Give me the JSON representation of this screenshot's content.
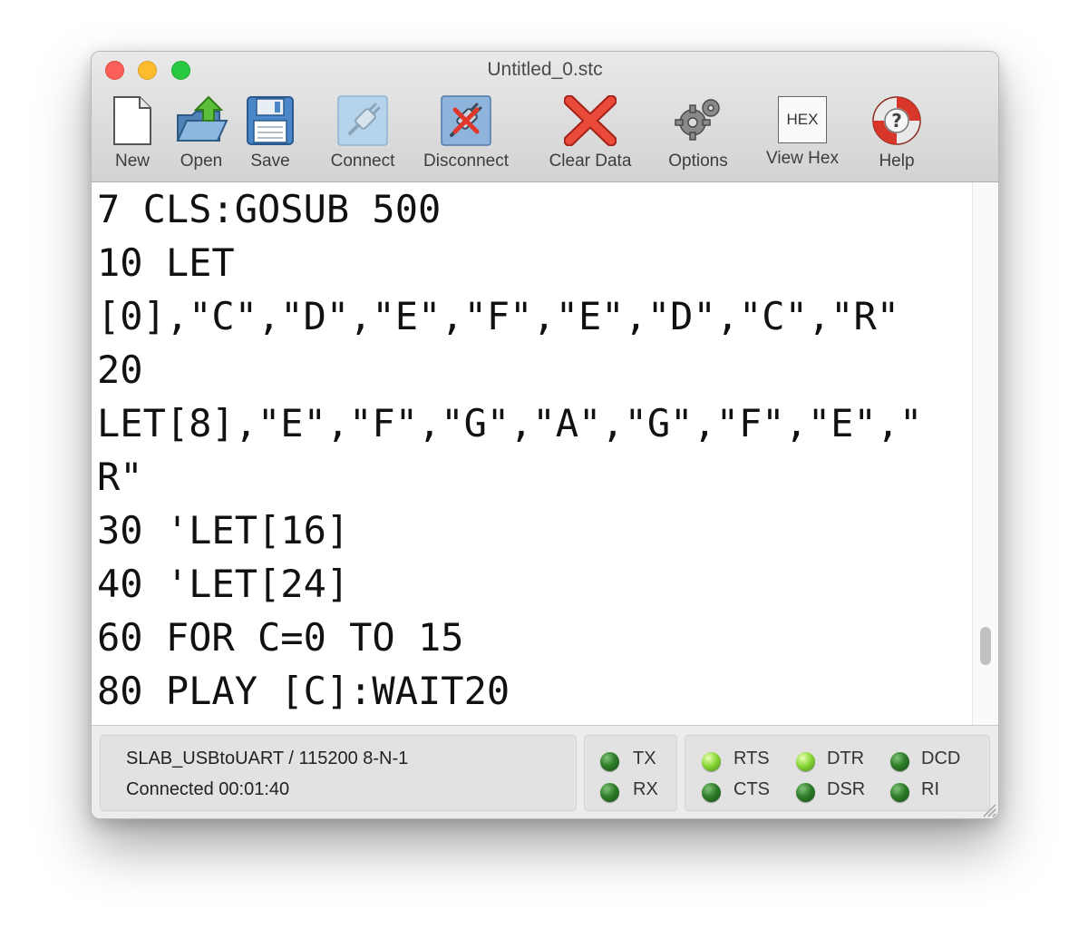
{
  "window": {
    "title": "Untitled_0.stc"
  },
  "toolbar": {
    "new_label": "New",
    "open_label": "Open",
    "save_label": "Save",
    "connect_label": "Connect",
    "disconnect_label": "Disconnect",
    "clear_label": "Clear Data",
    "options_label": "Options",
    "viewhex_label": "View Hex",
    "viewhex_icon_text": "HEX",
    "help_label": "Help"
  },
  "terminal": {
    "lines": [
      "7 CLS:GOSUB 500",
      "10 LET",
      "[0],\"C\",\"D\",\"E\",\"F\",\"E\",\"D\",\"C\",\"R\"",
      "20",
      "LET[8],\"E\",\"F\",\"G\",\"A\",\"G\",\"F\",\"E\",\"",
      "R\"",
      "30 'LET[16]",
      "40 'LET[24]",
      "60 FOR C=0 TO 15",
      "80 PLAY [C]:WAIT20"
    ]
  },
  "status": {
    "port": "SLAB_USBtoUART / 115200 8-N-1",
    "connection": "Connected 00:01:40",
    "leds": {
      "tx": {
        "label": "TX",
        "on": false
      },
      "rx": {
        "label": "RX",
        "on": false
      },
      "rts": {
        "label": "RTS",
        "on": true
      },
      "cts": {
        "label": "CTS",
        "on": false
      },
      "dtr": {
        "label": "DTR",
        "on": true
      },
      "dsr": {
        "label": "DSR",
        "on": false
      },
      "dcd": {
        "label": "DCD",
        "on": false
      },
      "ri": {
        "label": "RI",
        "on": false
      }
    }
  }
}
